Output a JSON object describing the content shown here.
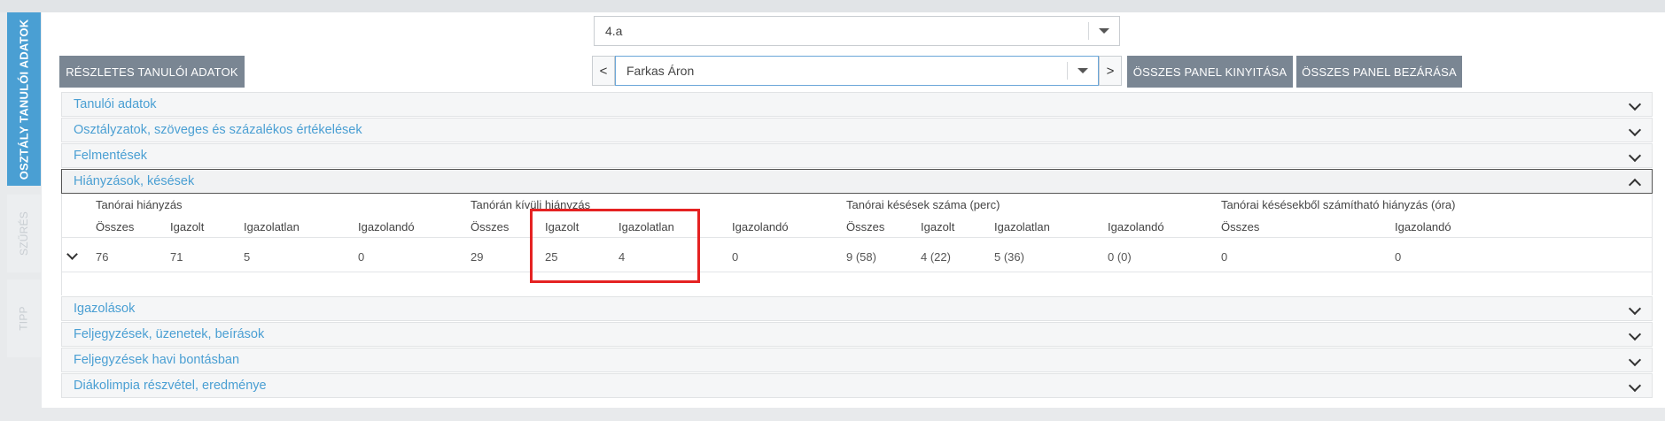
{
  "side_tabs": [
    {
      "label": "OSZTÁLY TANULÓI ADATOK",
      "active": true
    },
    {
      "label": "SZŰRÉS",
      "active": false
    },
    {
      "label": "TIPP",
      "active": false
    }
  ],
  "class_select": {
    "value": "4.a"
  },
  "student_select": {
    "value": "Farkas Áron"
  },
  "buttons": {
    "details": "RÉSZLETES TANULÓI ADATOK",
    "expand_all": "ÖSSZES PANEL KINYITÁSA",
    "collapse_all": "ÖSSZES PANEL BEZÁRÁSA"
  },
  "nav": {
    "prev": "<",
    "next": ">"
  },
  "panels": [
    {
      "label": "Tanulói adatok"
    },
    {
      "label": "Osztályzatok, szöveges és százalékos értékelések"
    },
    {
      "label": "Felmentések"
    },
    {
      "label": "Hiányzások, késések",
      "open": true
    },
    {
      "label": "Igazolások"
    },
    {
      "label": "Feljegyzések, üzenetek, beírások"
    },
    {
      "label": "Feljegyzések havi bontásban"
    },
    {
      "label": "Diákolimpia részvétel, eredménye"
    }
  ],
  "absence_table": {
    "groups": [
      "Tanórai hiányzás",
      "Tanórán kívüli hiányzás",
      "Tanórai késések száma (perc)",
      "Tanórai késésekből számítható hiányzás (óra)"
    ],
    "headers": [
      "Összes",
      "Igazolt",
      "Igazolatlan",
      "Igazolandó",
      "Összes",
      "Igazolt",
      "Igazolatlan",
      "Igazolandó",
      "Összes",
      "Igazolt",
      "Igazolatlan",
      "Igazolandó",
      "Összes",
      "Igazolandó"
    ],
    "values": [
      "76",
      "71",
      "5",
      "0",
      "29",
      "25",
      "4",
      "0",
      "9 (58)",
      "4 (22)",
      "5 (36)",
      "0 (0)",
      "0",
      "0"
    ]
  },
  "highlight": {
    "color": "#e52222"
  },
  "colors": {
    "accent": "#4a9fd3",
    "button": "#7a8693"
  }
}
